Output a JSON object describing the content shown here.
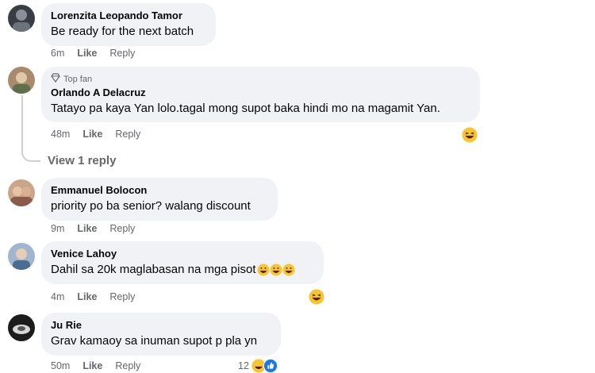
{
  "comments": [
    {
      "author": "Lorenzita Leopando Tamor",
      "text": "Be ready for the next batch",
      "time": "6m",
      "like": "Like",
      "reply": "Reply"
    },
    {
      "badge": "Top fan",
      "author": "Orlando A Delacruz",
      "text": "Tatayo pa kaya Yan lolo.tagal mong supot baka hindi mo na magamit Yan.",
      "time": "48m",
      "like": "Like",
      "reply": "Reply",
      "view_replies": "View 1 reply"
    },
    {
      "author": "Emmanuel Bolocon",
      "text": "priority po ba senior? walang discount",
      "time": "9m",
      "like": "Like",
      "reply": "Reply"
    },
    {
      "author": "Venice Lahoy",
      "text": "Dahil sa 20k maglabasan na mga pisot",
      "time": "4m",
      "like": "Like",
      "reply": "Reply"
    },
    {
      "author": "Ju Rie",
      "text": "Grav kamaoy sa inuman supot p pla yn",
      "time": "50m",
      "like": "Like",
      "reply": "Reply",
      "reaction_count": "12"
    }
  ],
  "colors": {
    "bubble": "#f0f2f5",
    "secondary_text": "#65676b",
    "like_blue": "#1877f2",
    "haha_yellow": "#f7c52d"
  },
  "icons": [
    "diamond-icon",
    "haha-reaction-icon",
    "like-reaction-icon"
  ]
}
